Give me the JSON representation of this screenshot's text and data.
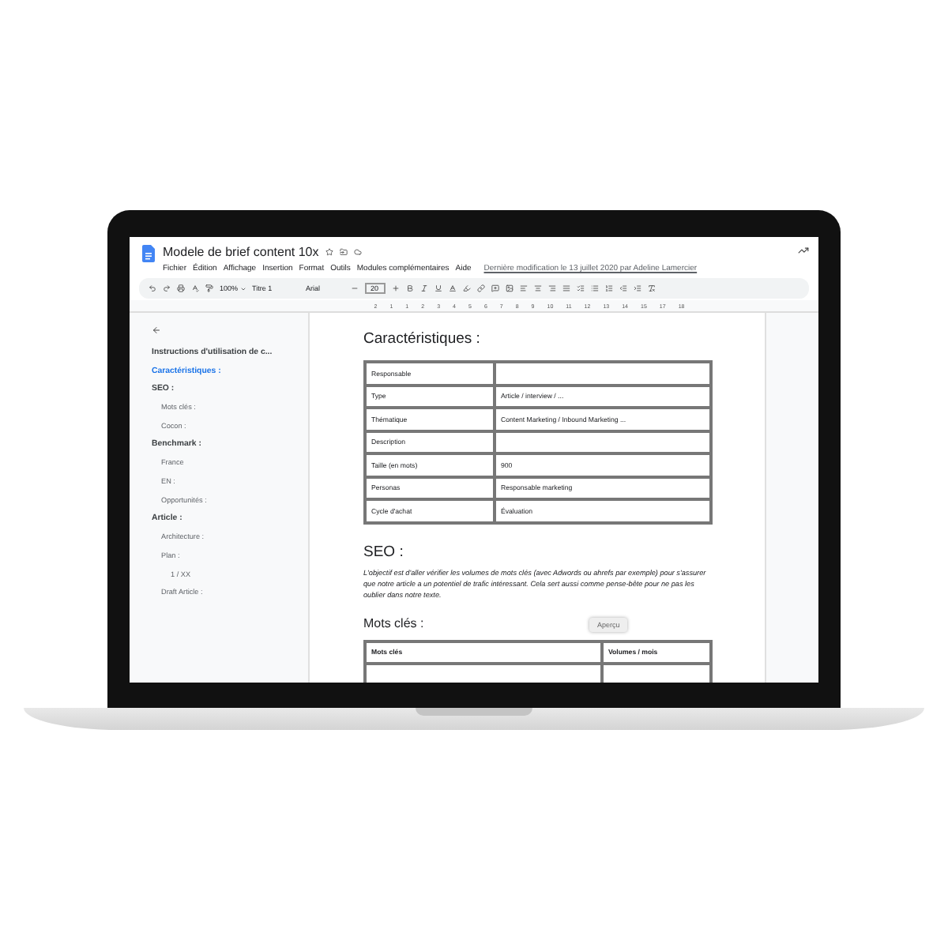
{
  "document": {
    "title": "Modele de brief content 10x"
  },
  "menu": [
    "Fichier",
    "Édition",
    "Affichage",
    "Insertion",
    "Format",
    "Outils",
    "Modules complémentaires",
    "Aide"
  ],
  "last_edit": "Dernière modification le 13 juillet 2020 par Adeline Lamercier",
  "toolbar": {
    "zoom": "100%",
    "style": "Titre 1",
    "font": "Arial",
    "size": "20"
  },
  "ruler": [
    "2",
    "1",
    "1",
    "2",
    "3",
    "4",
    "5",
    "6",
    "7",
    "8",
    "9",
    "10",
    "11",
    "12",
    "13",
    "14",
    "15",
    "17",
    "18"
  ],
  "outline": [
    {
      "label": "Instructions d'utilisation de c...",
      "selected": false
    },
    {
      "label": "Caractéristiques :",
      "selected": true
    },
    {
      "label": "SEO :",
      "selected": false,
      "children": [
        {
          "label": "Mots clés :",
          "selected": false
        },
        {
          "label": "Cocon :",
          "selected": false
        }
      ]
    },
    {
      "label": "Benchmark :",
      "selected": false,
      "children": [
        {
          "label": "France",
          "selected": false
        },
        {
          "label": "EN :",
          "selected": false
        },
        {
          "label": "Opportunités :",
          "selected": false
        }
      ]
    },
    {
      "label": "Article :",
      "selected": false,
      "children": [
        {
          "label": "Architecture :",
          "selected": false
        },
        {
          "label": "Plan :",
          "selected": false,
          "children": [
            {
              "label": "1 / XX",
              "selected": false
            }
          ]
        },
        {
          "label": "Draft Article :",
          "selected": false
        }
      ]
    }
  ],
  "page": {
    "heading": "Caractéristiques :",
    "table": [
      {
        "label": "Responsable"
      },
      {
        "label": "Type",
        "value": "Article / interview / ..."
      },
      {
        "label": "Thématique",
        "value": "Content Marketing / Inbound Marketing ..."
      },
      {
        "label": "Description"
      },
      {
        "label": "Taille (en mots)",
        "value": "900"
      },
      {
        "label": "Personas",
        "value": "Responsable marketing"
      },
      {
        "label": "Cycle d'achat",
        "value": "Évaluation"
      }
    ],
    "seo_heading": "SEO :",
    "seo_text": "L'objectif est d'aller vérifier les volumes de mots clés (avec Adwords ou ahrefs par exemple) pour s'assurer que notre article a un potentiel de trafic intéressant. Cela sert aussi comme pense-bête pour ne pas les oublier dans notre texte.",
    "keywords_heading": "Mots clés :",
    "keywords_columns": [
      "Mots clés",
      "Volumes / mois"
    ],
    "tooltip": "Aperçu"
  }
}
